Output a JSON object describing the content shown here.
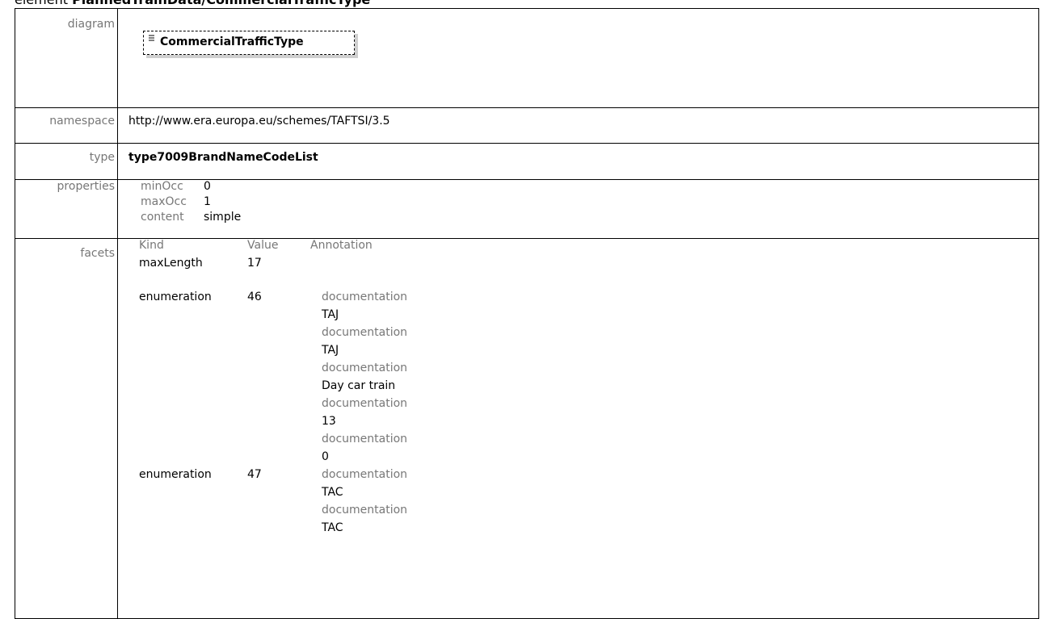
{
  "heading": {
    "prefix": "element",
    "path": "PlannedTrainData/CommercialTrafficType"
  },
  "diagram": {
    "label": "diagram",
    "element_name": "CommercialTrafficType"
  },
  "namespace": {
    "label": "namespace",
    "value": "http://www.era.europa.eu/schemes/TAFTSI/3.5"
  },
  "type": {
    "label": "type",
    "value": "type7009BrandNameCodeList"
  },
  "properties": {
    "label": "properties",
    "items": [
      {
        "key": "minOcc",
        "value": "0"
      },
      {
        "key": "maxOcc",
        "value": "1"
      },
      {
        "key": "content",
        "value": "simple"
      }
    ]
  },
  "facets": {
    "label": "facets",
    "headers": {
      "kind": "Kind",
      "value": "Value",
      "annotation": "Annotation"
    },
    "rows": [
      {
        "kind": "maxLength",
        "value": "17",
        "docs": []
      },
      {
        "kind": "enumeration",
        "value": "46",
        "docs": [
          {
            "label": "documentation",
            "text": "TAJ"
          },
          {
            "label": "documentation",
            "text": "TAJ"
          },
          {
            "label": "documentation",
            "text": "Day car train"
          },
          {
            "label": "documentation",
            "text": "13"
          },
          {
            "label": "documentation",
            "text": "0"
          }
        ]
      },
      {
        "kind": "enumeration",
        "value": "47",
        "docs": [
          {
            "label": "documentation",
            "text": "TAC"
          },
          {
            "label": "documentation",
            "text": "TAC"
          }
        ]
      }
    ]
  }
}
